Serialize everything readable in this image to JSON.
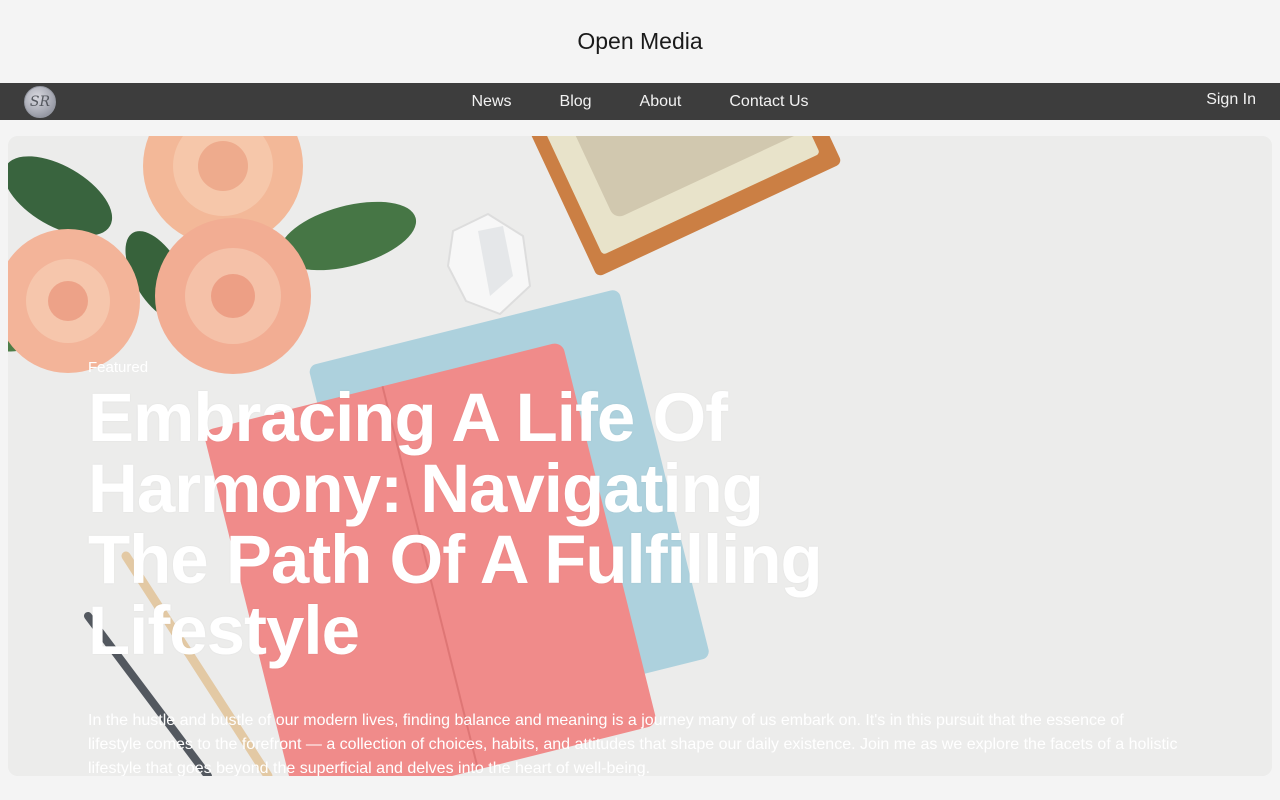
{
  "site": {
    "title": "Open Media"
  },
  "nav": {
    "logo_text": "SR",
    "links": [
      "News",
      "Blog",
      "About",
      "Contact Us"
    ],
    "signin_label": "Sign In"
  },
  "hero": {
    "label": "Featured",
    "title": "Embracing A Life Of Harmony: Navigating The Path Of A Fulfilling Lifestyle",
    "excerpt": "In the hustle and bustle of our modern lives, finding balance and meaning is a journey many of us embark on. It's in this pursuit that the essence of lifestyle comes to the forefront — a collection of choices, habits, and attitudes that shape our daily existence. Join me as we explore the facets of a holistic lifestyle that goes beyond the superficial and delves into the heart of well-being."
  },
  "colors": {
    "page_bg": "#f4f4f4",
    "nav_bg": "#3d3d3d",
    "nav_text": "#f2f2f2",
    "hero_text": "#ffffff"
  }
}
